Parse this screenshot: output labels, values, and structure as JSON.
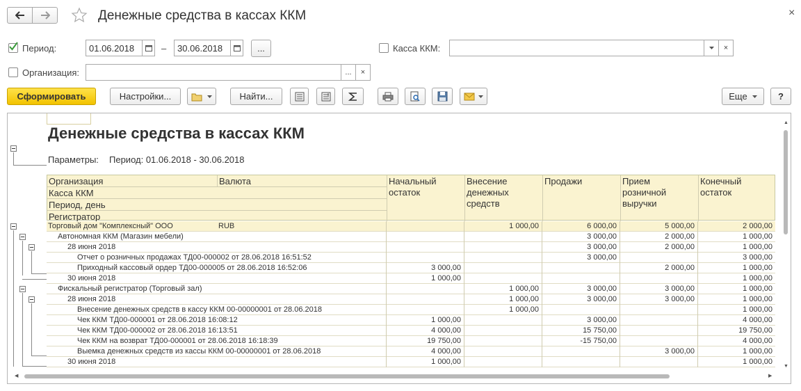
{
  "window": {
    "title": "Денежные средства в кассах ККМ",
    "close": "×"
  },
  "filters": {
    "period_label": "Период:",
    "period_from": "01.06.2018",
    "period_dash": "–",
    "period_to": "30.06.2018",
    "period_more": "...",
    "kassa_label": "Касса ККМ:",
    "kassa_value": "",
    "org_label": "Организация:",
    "org_value": "",
    "dots": "...",
    "clear": "×"
  },
  "toolbar": {
    "generate": "Сформировать",
    "settings": "Настройки...",
    "find": "Найти...",
    "more": "Еще",
    "help": "?"
  },
  "report": {
    "title": "Денежные средства в кассах ККМ",
    "params_label": "Параметры:",
    "params_value": "Период: 01.06.2018 - 30.06.2018",
    "headers": {
      "org": "Организация",
      "currency": "Валюта",
      "kassa": "Касса ККМ",
      "period": "Период, день",
      "registrar": "Регистратор",
      "start": "Начальный остаток",
      "deposit": "Внесение денежных средств",
      "sales": "Продажи",
      "receipt": "Прием розничной выручки",
      "end": "Конечный остаток"
    },
    "rows": [
      {
        "label": "Торговый дом \"Комплексный\" ООО",
        "currency": "RUB",
        "start": "",
        "deposit": "1 000,00",
        "sales": "6 000,00",
        "receipt": "5 000,00",
        "end": "2 000,00"
      },
      {
        "label": "Автономная ККМ (Магазин мебели)",
        "currency": "",
        "start": "",
        "deposit": "",
        "sales": "3 000,00",
        "receipt": "2 000,00",
        "end": "1 000,00"
      },
      {
        "label": "28 июня 2018",
        "currency": "",
        "start": "",
        "deposit": "",
        "sales": "3 000,00",
        "receipt": "2 000,00",
        "end": "1 000,00"
      },
      {
        "label": "Отчет о розничных продажах ТД00-000002 от 28.06.2018 16:51:52",
        "currency": "",
        "start": "",
        "deposit": "",
        "sales": "3 000,00",
        "receipt": "",
        "end": "3 000,00"
      },
      {
        "label": "Приходный кассовый ордер ТД00-000005 от 28.06.2018 16:52:06",
        "currency": "",
        "start": "3 000,00",
        "deposit": "",
        "sales": "",
        "receipt": "2 000,00",
        "end": "1 000,00"
      },
      {
        "label": "30 июня 2018",
        "currency": "",
        "start": "1 000,00",
        "deposit": "",
        "sales": "",
        "receipt": "",
        "end": "1 000,00"
      },
      {
        "label": "Фискальный регистратор (Торговый зал)",
        "currency": "",
        "start": "",
        "deposit": "1 000,00",
        "sales": "3 000,00",
        "receipt": "3 000,00",
        "end": "1 000,00"
      },
      {
        "label": "28 июня 2018",
        "currency": "",
        "start": "",
        "deposit": "1 000,00",
        "sales": "3 000,00",
        "receipt": "3 000,00",
        "end": "1 000,00"
      },
      {
        "label": "Внесение денежных средств в кассу ККМ 00-00000001 от 28.06.2018",
        "currency": "",
        "start": "",
        "deposit": "1 000,00",
        "sales": "",
        "receipt": "",
        "end": "1 000,00"
      },
      {
        "label": "Чек ККМ ТД00-000001 от 28.06.2018 16:08:12",
        "currency": "",
        "start": "1 000,00",
        "deposit": "",
        "sales": "3 000,00",
        "receipt": "",
        "end": "4 000,00"
      },
      {
        "label": "Чек ККМ ТД00-000002 от 28.06.2018 16:13:51",
        "currency": "",
        "start": "4 000,00",
        "deposit": "",
        "sales": "15 750,00",
        "receipt": "",
        "end": "19 750,00"
      },
      {
        "label": "Чек ККМ на возврат ТД00-000001 от 28.06.2018 16:18:39",
        "currency": "",
        "start": "19 750,00",
        "deposit": "",
        "sales": "-15 750,00",
        "receipt": "",
        "end": "4 000,00"
      },
      {
        "label": "Выемка денежных средств из кассы ККМ 00-00000001 от 28.06.2018",
        "currency": "",
        "start": "4 000,00",
        "deposit": "",
        "sales": "",
        "receipt": "3 000,00",
        "end": "1 000,00"
      },
      {
        "label": "30 июня 2018",
        "currency": "",
        "start": "1 000,00",
        "deposit": "",
        "sales": "",
        "receipt": "",
        "end": "1 000,00"
      }
    ]
  },
  "icons": {
    "back": "arrow-left-icon",
    "forward": "arrow-right-icon",
    "favorite": "star-icon",
    "calendar": "calendar-icon",
    "print": "printer-icon",
    "preview": "print-preview-icon",
    "save": "floppy-icon",
    "mail": "envelope-icon",
    "sum": "sigma-icon"
  }
}
